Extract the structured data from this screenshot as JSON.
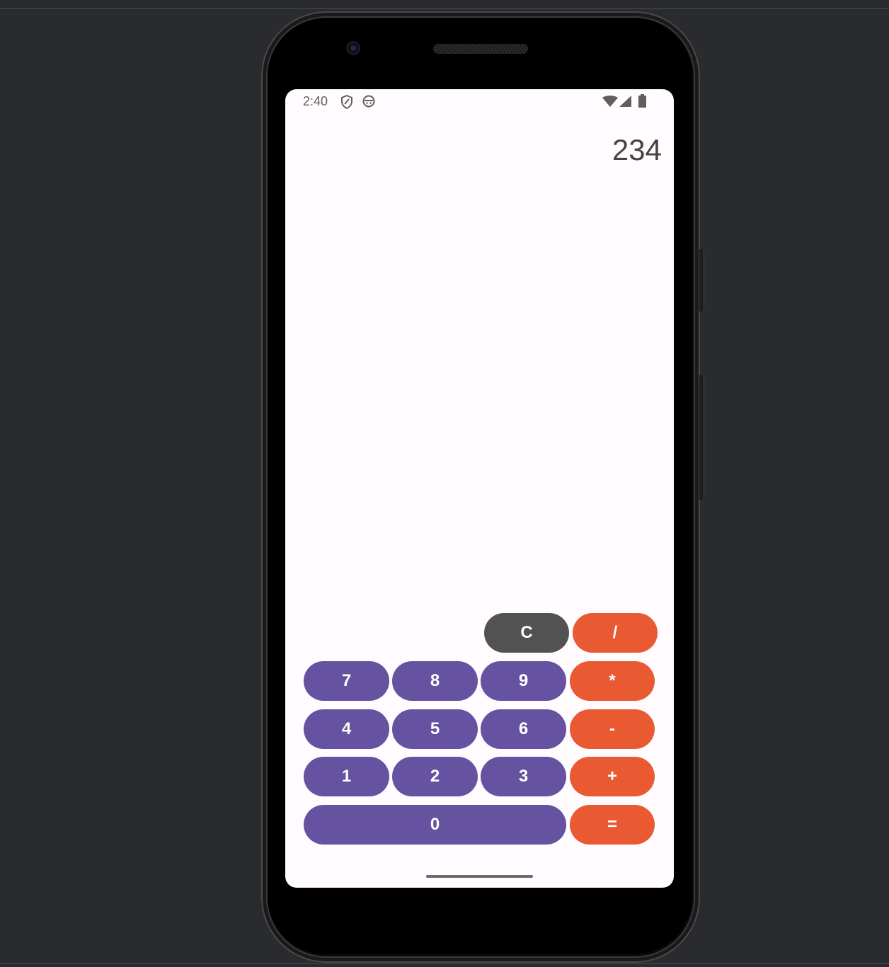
{
  "status_bar": {
    "time": "2:40",
    "left_icons": [
      "shield-icon",
      "android-debug-icon"
    ],
    "right_icons": [
      "wifi-icon",
      "cell-signal-icon",
      "battery-icon"
    ]
  },
  "display": {
    "value": "234"
  },
  "keypad": {
    "clear": "C",
    "divide": "/",
    "multiply": "*",
    "subtract": "-",
    "add": "+",
    "equals": "=",
    "digits": {
      "d7": "7",
      "d8": "8",
      "d9": "9",
      "d4": "4",
      "d5": "5",
      "d6": "6",
      "d1": "1",
      "d2": "2",
      "d3": "3",
      "d0": "0"
    }
  },
  "colors": {
    "number_key": "#6552a0",
    "operator_key": "#e95932",
    "clear_key": "#525252",
    "screen_background": "#fffbfe",
    "display_text": "#444444"
  }
}
